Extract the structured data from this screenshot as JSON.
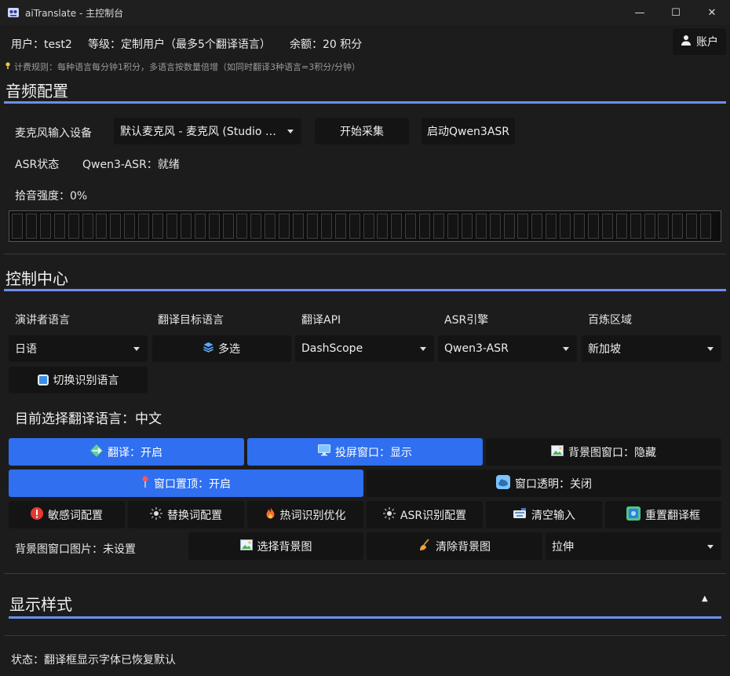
{
  "window": {
    "title": "aiTranslate - 主控制台",
    "minimize": "—",
    "maximize": "☐",
    "close": "✕"
  },
  "header": {
    "user": "用户：test2",
    "level": "等级：定制用户（最多5个翻译语言）",
    "balance": "余额：20 积分",
    "account_button": "账户",
    "billing_rule": "计费规则：每种语言每分钟1积分，多语言按数量倍增（如同时翻译3种语言=3积分/分钟）"
  },
  "audio": {
    "title": "音频配置",
    "mic_label": "麦克风输入设备",
    "mic_value": "默认麦克风 - 麦克风 (Studio …",
    "start_capture": "开始采集",
    "start_asr": "启动Qwen3ASR",
    "asr_status_label": "ASR状态",
    "asr_status_value": "Qwen3-ASR：就绪",
    "pickup_level": "拾音强度：0%",
    "level_percent": 0
  },
  "control": {
    "title": "控制中心",
    "col_labels": [
      "演讲者语言",
      "翻译目标语言",
      "翻译API",
      "ASR引擎",
      "百炼区域"
    ],
    "speaker_lang": "日语",
    "multi_select": "多选",
    "api": "DashScope",
    "asr_engine": "Qwen3-ASR",
    "region": "新加坡",
    "switch_lang": "切换识别语言",
    "current_target": "目前选择翻译语言：中文",
    "translate_toggle": "翻译：开启",
    "projection_toggle": "投屏窗口：显示",
    "bg_window_toggle": "背景图窗口：隐藏",
    "pin_toggle": "窗口置顶：开启",
    "transparency_toggle": "窗口透明：关闭",
    "sensitive_words": "敏感词配置",
    "replace_words": "替换词配置",
    "hotword": "热词识别优化",
    "asr_config": "ASR识别配置",
    "clear_input": "清空输入",
    "reset_frame": "重置翻译框",
    "bg_image_label": "背景图窗口图片：未设置",
    "choose_bg": "选择背景图",
    "clear_bg": "清除背景图",
    "stretch_mode": "拉伸"
  },
  "display": {
    "title": "显示样式",
    "collapse_glyph": "▲"
  },
  "status": {
    "text": "状态：翻译框显示字体已恢复默认"
  },
  "colors": {
    "accent": "#2f6ff0",
    "section_bar": "#6d8ef0",
    "background": "#1c1c1c",
    "button": "#141414"
  }
}
